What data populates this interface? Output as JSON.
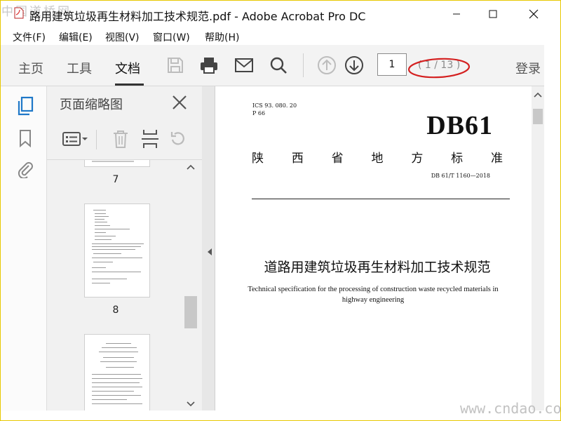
{
  "window": {
    "title": "路用建筑垃圾再生材料加工技术规范.pdf - Adobe Acrobat Pro DC",
    "watermark_top": "中国道桥网",
    "minimize_icon": "minimize-icon",
    "maximize_icon": "maximize-icon",
    "close_icon": "close-icon"
  },
  "menu": [
    "文件(F)",
    "编辑(E)",
    "视图(V)",
    "窗口(W)",
    "帮助(H)"
  ],
  "toolbar": {
    "tabs": [
      "主页",
      "工具",
      "文档"
    ],
    "active_tab": "文档",
    "page_number": "1",
    "page_count": "( 1 / 13 )",
    "login": "登录",
    "annotation_color": "#d42020"
  },
  "thumbnails_panel": {
    "title": "页面缩略图",
    "pages": [
      {
        "label": "7"
      },
      {
        "label": "8"
      }
    ]
  },
  "document": {
    "ics": "ICS  93. 080. 20",
    "ccs": "P  66",
    "standard_code": "DB61",
    "standard_name": [
      "陕",
      "西",
      "省",
      "地",
      "方",
      "标",
      "准"
    ],
    "standard_number": "DB 61/T  1160—2018",
    "title_cn": "道路用建筑垃圾再生材料加工技术规范",
    "title_en": "Technical specification for the processing of construction waste recycled materials in highway engineering"
  },
  "watermark_bottom": "www.cndao.com"
}
